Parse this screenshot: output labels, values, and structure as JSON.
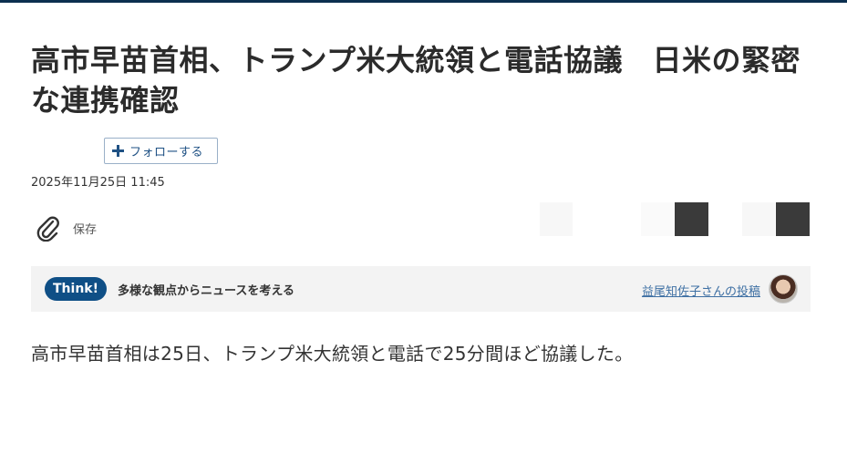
{
  "article": {
    "headline": "高市早苗首相、トランプ米大統領と電話協議　日米の緊密な連携確認",
    "follow_label": "フォローする",
    "timestamp": "2025年11月25日 11:45",
    "save_label": "保存",
    "lead": "高市早苗首相は25日、トランプ米大統領と電話で25分間ほど協議した。"
  },
  "think": {
    "badge": "Think!",
    "text": "多様な観点からニュースを考える",
    "author_link": "益尾知佐子さんの投稿"
  },
  "icons": {
    "save": "paperclip-icon",
    "follow": "plus-icon"
  },
  "colors": {
    "brand": "#0f4f86",
    "topbar": "#0b2f4f",
    "link": "#3d6fa3"
  }
}
